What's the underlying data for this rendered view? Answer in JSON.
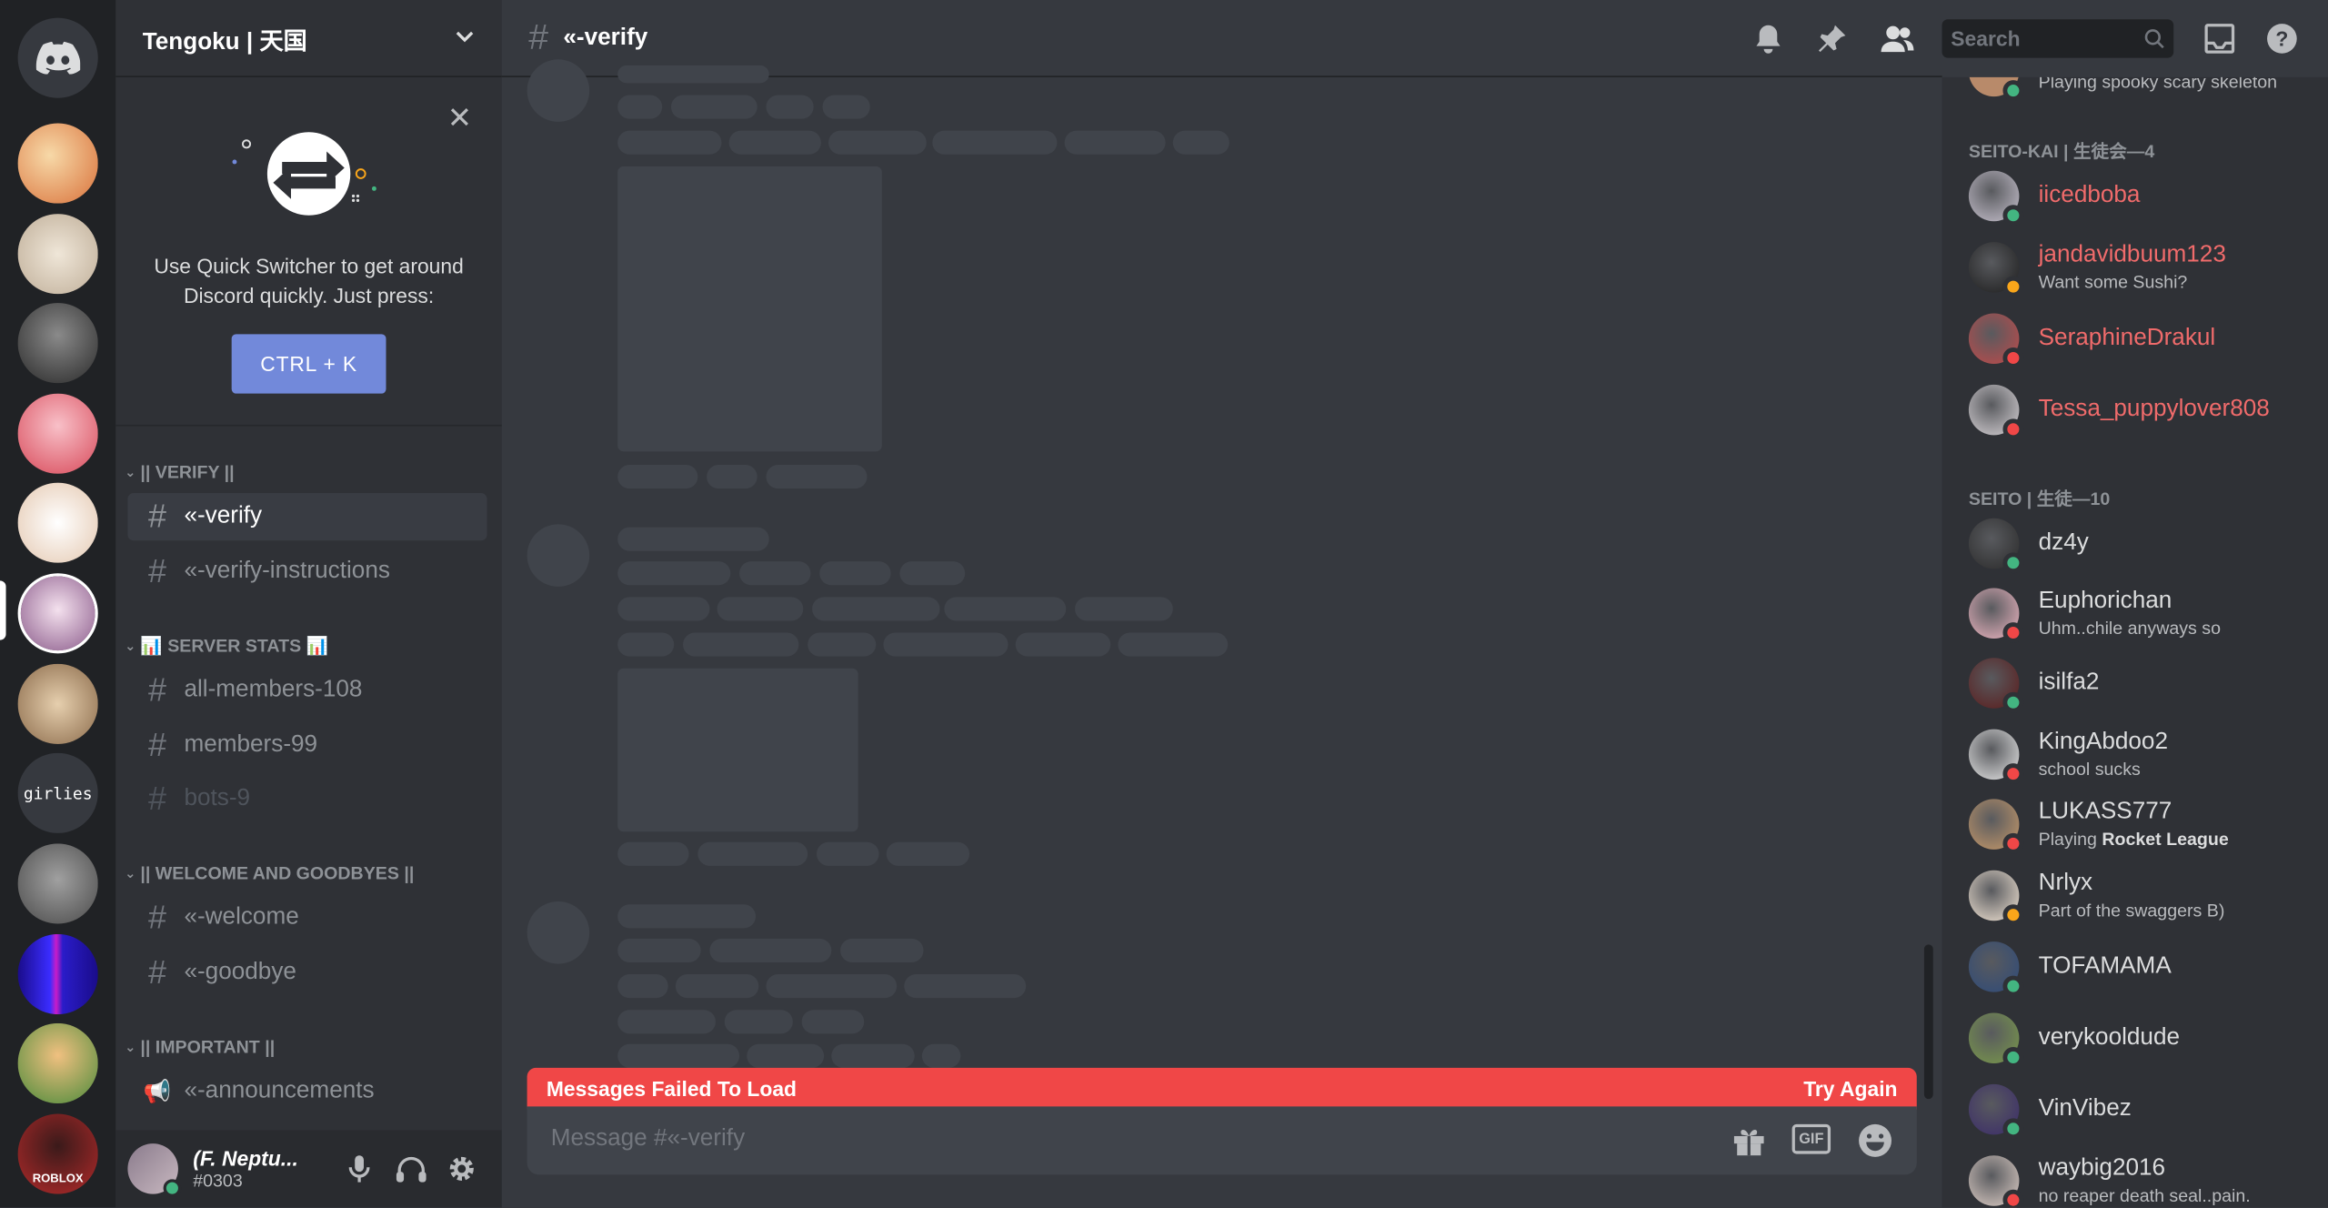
{
  "server": {
    "name": "Tengoku | 天国",
    "rail": [
      {
        "name": "home",
        "color": "#36393f"
      },
      {
        "name": "server-1",
        "color": "#e9a35d"
      },
      {
        "name": "server-2",
        "color": "#d8cfc0"
      },
      {
        "name": "server-3",
        "color": "#4a4a4a"
      },
      {
        "name": "server-4",
        "color": "#e86a7a"
      },
      {
        "name": "server-5",
        "color": "#f1e6dc"
      },
      {
        "name": "server-6",
        "color": "#c9a9c6"
      },
      {
        "name": "server-7",
        "color": "#b89b7a"
      },
      {
        "name": "server-girlies",
        "label": "girlies",
        "color": "#36393f"
      },
      {
        "name": "server-9",
        "color": "#6b6b6b"
      },
      {
        "name": "server-10",
        "color": "#2a1cc9"
      },
      {
        "name": "server-11",
        "color": "#7fb35a"
      },
      {
        "name": "server-roblox",
        "color": "#b32a2a",
        "label": "ROBLOX"
      }
    ]
  },
  "switcher": {
    "text_line1": "Use Quick Switcher to get around",
    "text_line2": "Discord quickly. Just press:",
    "shortcut": "CTRL + K"
  },
  "categories": [
    {
      "label": "|| VERIFY ||"
    },
    {
      "label": "📊 SERVER STATS 📊"
    },
    {
      "label": "|| WELCOME AND GOODBYES ||"
    },
    {
      "label": "|| IMPORTANT ||"
    }
  ],
  "channels": [
    {
      "label": "«-verify",
      "selected": true
    },
    {
      "label": "«-verify-instructions"
    },
    {
      "label": "all-members-108"
    },
    {
      "label": "members-99"
    },
    {
      "label": "bots-9",
      "muted": true
    },
    {
      "label": "«-welcome"
    },
    {
      "label": "«-goodbye"
    },
    {
      "label": "«-announcements",
      "announce": true
    }
  ],
  "user": {
    "name": "(F. Neptu...",
    "tag": "#0303"
  },
  "chat": {
    "channel": "«-verify",
    "search_placeholder": "Search",
    "error": "Messages Failed To Load",
    "retry": "Try Again",
    "composer_placeholder": "Message #«-verify",
    "gif": "GIF"
  },
  "members": {
    "top_sub": "Playing spooky scary skeleton",
    "groups": [
      {
        "label": "SEITO-KAI | 生徒会—4"
      },
      {
        "label": "SEITO | 生徒—10"
      }
    ],
    "list": [
      {
        "name": "iicedboba",
        "color": "#f06b6b",
        "status": "#43b581",
        "avatar": "#c8c2cf"
      },
      {
        "name": "jandavidbuum123",
        "sub": "Want some Sushi?",
        "color": "#f06b6b",
        "status": "#faa61a",
        "avatar": "#1d1d1d"
      },
      {
        "name": "SeraphineDrakul",
        "color": "#f06b6b",
        "status": "#f04747",
        "avatar": "#c24a4a"
      },
      {
        "name": "Tessa_puppylover808",
        "color": "#f06b6b",
        "status": "#f04747",
        "avatar": "#d9d4d8"
      },
      {
        "name": "dz4y",
        "color": "#dcddde",
        "status": "#43b581",
        "avatar": "#2a2a2a"
      },
      {
        "name": "Euphorichan",
        "sub": "Uhm..chile anyways so",
        "color": "#dcddde",
        "status": "#f04747",
        "avatar": "#f0b7c3"
      },
      {
        "name": "isilfa2",
        "color": "#dcddde",
        "status": "#43b581",
        "avatar": "#5a1a1a"
      },
      {
        "name": "KingAbdoo2",
        "sub": "school sucks",
        "color": "#dcddde",
        "status": "#f04747",
        "avatar": "#e8e8e8"
      },
      {
        "name": "LUKASS777",
        "sub_prefix": "Playing ",
        "sub_bold": "Rocket League",
        "color": "#dcddde",
        "status": "#f04747",
        "avatar": "#c89a6a"
      },
      {
        "name": "Nrlyx",
        "sub": "Part of the swaggers B)",
        "color": "#dcddde",
        "status": "#faa61a",
        "avatar": "#f4e6d6"
      },
      {
        "name": "TOFAMAMA",
        "color": "#dcddde",
        "status": "#43b581",
        "avatar": "#2d4a7a"
      },
      {
        "name": "verykooldude",
        "color": "#dcddde",
        "status": "#43b581",
        "avatar": "#7a9a4a"
      },
      {
        "name": "VinVibez",
        "color": "#dcddde",
        "status": "#43b581",
        "avatar": "#3a2a6a"
      },
      {
        "name": "waybig2016",
        "sub": "no reaper death seal..pain.",
        "color": "#dcddde",
        "status": "#f04747",
        "avatar": "#e0d0c8"
      }
    ]
  }
}
